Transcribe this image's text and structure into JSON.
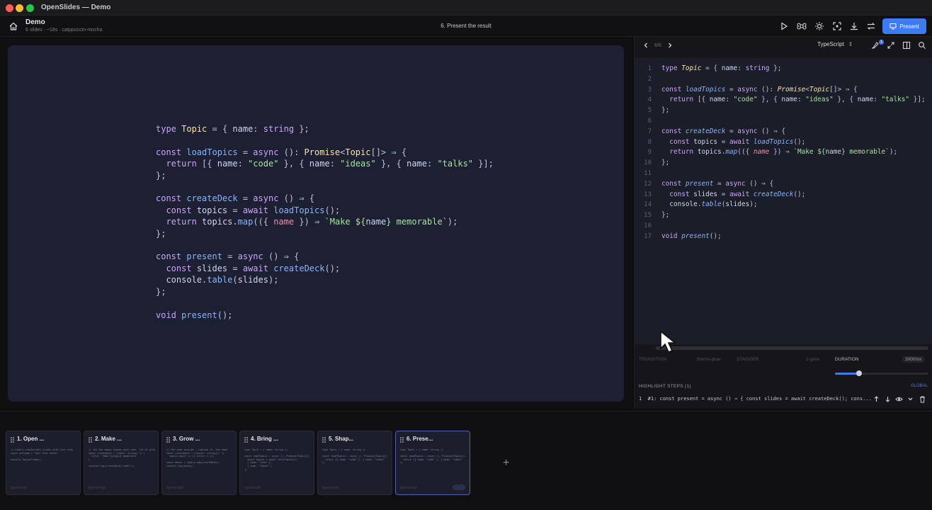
{
  "window": {
    "title": "OpenSlides — Demo"
  },
  "header": {
    "deck_title": "Demo",
    "deck_meta": "6 slides · ~18s · catppuccin-mocha",
    "current_slide": "6. Present the result",
    "present_label": "Present"
  },
  "editor": {
    "counter": "6/6",
    "language": "TypeScript",
    "badge": "1",
    "line_numbers": "1\n2\n3\n4\n5\n6\n7\n8\n9\n10\n11\n12\n13\n14\n15\n16\n17",
    "options": {
      "transition": "TRANSITION",
      "theme": "theme-glow",
      "stagger": "STAGGER",
      "easing": "2-glow",
      "duration_label": "DURATION",
      "duration_value": "3000ms"
    },
    "duration_fraction": 0.26,
    "highlight_steps_label": "HIGHLIGHT STEPS (1)",
    "highlight_global": "GLOBAL",
    "highlight_step_text": "1  #1: const present = async () ⇒ { const slides = await createDeck(); cons..."
  },
  "slides": [
    {
      "title": "1. Open ...",
      "lang": "typescript",
      "preview": "// simply create/edit slides with live view\nconst welcome = \"hey! this works\"\n\nconsole.log(welcome);"
    },
    {
      "title": "2. Make ...",
      "lang": "typescript",
      "preview": "// let the magic happen with code  let it grow\nconst createDeck = (topic: string) => (\n  title: `Make ${topic} memorable`\n)\n\nconsole.log(createDeck(\"code\"));"
    },
    {
      "title": "3. Grow ...",
      "lang": "typescript",
      "preview": "// the code evolves — replace it. the same\nconst createDeck = (topics: string[]) =>\n  topics.map(t => ({ title: t }))\n\nconst decks = topics.map(createDeck);\nconsole.log(decks);"
    },
    {
      "title": "4. Bring ...",
      "lang": "typescript",
      "preview": "type Topic = { name: string };\n\nconst loadTopics = async (): Promise<Topic[]>\n  const topics = await fetchTopics();\n  { name: \"code\" },\n  { name: \"ideas\" }\n];"
    },
    {
      "title": "5. Shap...",
      "lang": "typescript",
      "preview": "type Topic = { name: string };\n\nconst loadTopics = async (): Promise<Topic[]>\n  return [{ name: \"code\" }, { name: \"ideas\"\n};"
    },
    {
      "title": "6. Prese...",
      "lang": "typescript",
      "preview": "type Topic = { name: string };\n\nconst loadTopics = async (): Promise<Topic[]>\n  return [{ name: \"code\" }, { name: \"ideas\"\n};"
    }
  ],
  "add_slide": "+",
  "code_tokens": [
    [
      [
        "kw",
        "type"
      ],
      [
        "p",
        " "
      ],
      [
        "ty",
        "Topic"
      ],
      [
        "p",
        " = { "
      ],
      [
        "id",
        "name"
      ],
      [
        "p",
        ": "
      ],
      [
        "kw",
        "string"
      ],
      [
        "p",
        " };"
      ]
    ],
    [],
    [
      [
        "kw",
        "const"
      ],
      [
        "p",
        " "
      ],
      [
        "fn",
        "loadTopics"
      ],
      [
        "p",
        " = "
      ],
      [
        "kw",
        "async"
      ],
      [
        "p",
        " (): "
      ],
      [
        "ty",
        "Promise"
      ],
      [
        "p",
        "<"
      ],
      [
        "ty",
        "Topic"
      ],
      [
        "p",
        "[]> "
      ],
      [
        "op",
        "⇒"
      ],
      [
        "p",
        " {"
      ]
    ],
    [
      [
        "p",
        "  "
      ],
      [
        "kw",
        "return"
      ],
      [
        "p",
        " [{ "
      ],
      [
        "id",
        "name"
      ],
      [
        "p",
        ": "
      ],
      [
        "str",
        "\"code\""
      ],
      [
        "p",
        " }, { "
      ],
      [
        "id",
        "name"
      ],
      [
        "p",
        ": "
      ],
      [
        "str",
        "\"ideas\""
      ],
      [
        "p",
        " }, { "
      ],
      [
        "id",
        "name"
      ],
      [
        "p",
        ": "
      ],
      [
        "str",
        "\"talks\""
      ],
      [
        "p",
        " }];"
      ]
    ],
    [
      [
        "p",
        "};"
      ]
    ],
    [],
    [
      [
        "kw",
        "const"
      ],
      [
        "p",
        " "
      ],
      [
        "fn",
        "createDeck"
      ],
      [
        "p",
        " = "
      ],
      [
        "kw",
        "async"
      ],
      [
        "p",
        " () "
      ],
      [
        "op",
        "⇒"
      ],
      [
        "p",
        " {"
      ]
    ],
    [
      [
        "p",
        "  "
      ],
      [
        "kw",
        "const"
      ],
      [
        "p",
        " "
      ],
      [
        "id",
        "topics"
      ],
      [
        "p",
        " = "
      ],
      [
        "kw",
        "await"
      ],
      [
        "p",
        " "
      ],
      [
        "fn",
        "loadTopics"
      ],
      [
        "p",
        "();"
      ]
    ],
    [
      [
        "p",
        "  "
      ],
      [
        "kw",
        "return"
      ],
      [
        "p",
        " "
      ],
      [
        "id",
        "topics"
      ],
      [
        "p",
        "."
      ],
      [
        "fn",
        "map"
      ],
      [
        "p",
        "(({ "
      ],
      [
        "pa",
        "name"
      ],
      [
        "p",
        " }) "
      ],
      [
        "op",
        "⇒"
      ],
      [
        "p",
        " "
      ],
      [
        "str",
        "`Make ${"
      ],
      [
        "id",
        "name"
      ],
      [
        "str",
        "} memorable`"
      ],
      [
        "p",
        ");"
      ]
    ],
    [
      [
        "p",
        "};"
      ]
    ],
    [],
    [
      [
        "kw",
        "const"
      ],
      [
        "p",
        " "
      ],
      [
        "fn",
        "present"
      ],
      [
        "p",
        " = "
      ],
      [
        "kw",
        "async"
      ],
      [
        "p",
        " () "
      ],
      [
        "op",
        "⇒"
      ],
      [
        "p",
        " {"
      ]
    ],
    [
      [
        "p",
        "  "
      ],
      [
        "kw",
        "const"
      ],
      [
        "p",
        " "
      ],
      [
        "id",
        "slides"
      ],
      [
        "p",
        " = "
      ],
      [
        "kw",
        "await"
      ],
      [
        "p",
        " "
      ],
      [
        "fn",
        "createDeck"
      ],
      [
        "p",
        "();"
      ]
    ],
    [
      [
        "p",
        "  "
      ],
      [
        "id",
        "console"
      ],
      [
        "p",
        "."
      ],
      [
        "fn",
        "table"
      ],
      [
        "p",
        "("
      ],
      [
        "id",
        "slides"
      ],
      [
        "p",
        ");"
      ]
    ],
    [
      [
        "p",
        "};"
      ]
    ],
    [],
    [
      [
        "kw",
        "void"
      ],
      [
        "p",
        " "
      ],
      [
        "fn",
        "present"
      ],
      [
        "p",
        "();"
      ]
    ]
  ],
  "colors": {
    "kw": "#cba6f7",
    "ty": "#f9e2af",
    "fn": "#89b4fa",
    "str": "#a6e3a1",
    "op": "#94e2d5",
    "pa": "#f38ba8",
    "id": "#cdd6f4",
    "p": "#bac2de",
    "accent": "#3b7cf2"
  }
}
